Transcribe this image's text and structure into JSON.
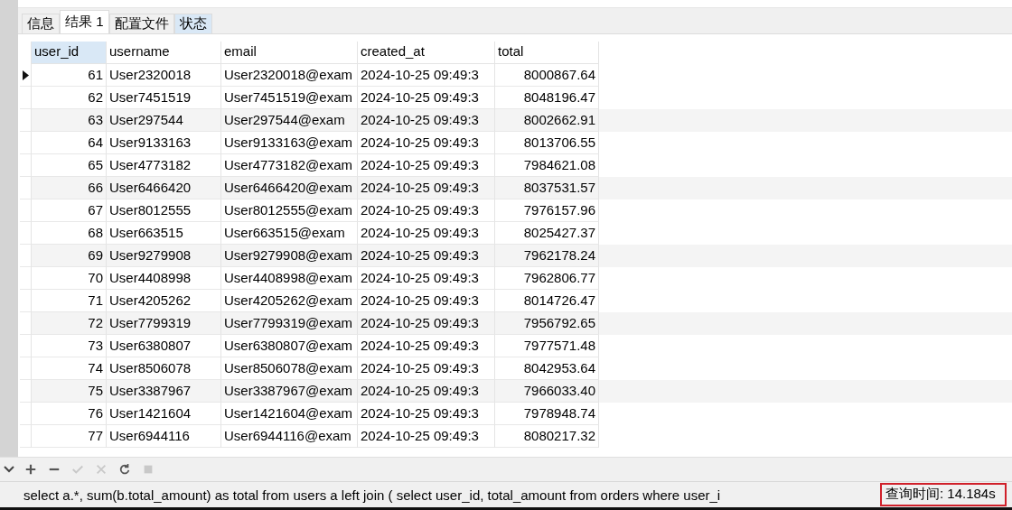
{
  "tabs": [
    {
      "label": "信息",
      "selected": false
    },
    {
      "label": "结果 1",
      "selected": true
    },
    {
      "label": "配置文件",
      "selected": false
    },
    {
      "label": "状态",
      "selected": false
    }
  ],
  "table": {
    "columns": [
      "user_id",
      "username",
      "email",
      "created_at",
      "total"
    ],
    "rows": [
      {
        "selected": true,
        "cells": [
          "61",
          "User2320018",
          "User2320018@exam",
          "2024-10-25 09:49:3",
          "8000867.64"
        ]
      },
      {
        "selected": false,
        "cells": [
          "62",
          "User7451519",
          "User7451519@exam",
          "2024-10-25 09:49:3",
          "8048196.47"
        ]
      },
      {
        "selected": false,
        "cells": [
          "63",
          "User297544",
          "User297544@exam",
          "2024-10-25 09:49:3",
          "8002662.91"
        ]
      },
      {
        "selected": false,
        "cells": [
          "64",
          "User9133163",
          "User9133163@exam",
          "2024-10-25 09:49:3",
          "8013706.55"
        ]
      },
      {
        "selected": false,
        "cells": [
          "65",
          "User4773182",
          "User4773182@exam",
          "2024-10-25 09:49:3",
          "7984621.08"
        ]
      },
      {
        "selected": false,
        "cells": [
          "66",
          "User6466420",
          "User6466420@exam",
          "2024-10-25 09:49:3",
          "8037531.57"
        ]
      },
      {
        "selected": false,
        "cells": [
          "67",
          "User8012555",
          "User8012555@exam",
          "2024-10-25 09:49:3",
          "7976157.96"
        ]
      },
      {
        "selected": false,
        "cells": [
          "68",
          "User663515",
          "User663515@exam",
          "2024-10-25 09:49:3",
          "8025427.37"
        ]
      },
      {
        "selected": false,
        "cells": [
          "69",
          "User9279908",
          "User9279908@exam",
          "2024-10-25 09:49:3",
          "7962178.24"
        ]
      },
      {
        "selected": false,
        "cells": [
          "70",
          "User4408998",
          "User4408998@exam",
          "2024-10-25 09:49:3",
          "7962806.77"
        ]
      },
      {
        "selected": false,
        "cells": [
          "71",
          "User4205262",
          "User4205262@exam",
          "2024-10-25 09:49:3",
          "8014726.47"
        ]
      },
      {
        "selected": false,
        "cells": [
          "72",
          "User7799319",
          "User7799319@exam",
          "2024-10-25 09:49:3",
          "7956792.65"
        ]
      },
      {
        "selected": false,
        "cells": [
          "73",
          "User6380807",
          "User6380807@exam",
          "2024-10-25 09:49:3",
          "7977571.48"
        ]
      },
      {
        "selected": false,
        "cells": [
          "74",
          "User8506078",
          "User8506078@exam",
          "2024-10-25 09:49:3",
          "8042953.64"
        ]
      },
      {
        "selected": false,
        "cells": [
          "75",
          "User3387967",
          "User3387967@exam",
          "2024-10-25 09:49:3",
          "7966033.40"
        ]
      },
      {
        "selected": false,
        "cells": [
          "76",
          "User1421604",
          "User1421604@exam",
          "2024-10-25 09:49:3",
          "7978948.74"
        ]
      },
      {
        "selected": false,
        "cells": [
          "77",
          "User6944116",
          "User6944116@exam",
          "2024-10-25 09:49:3",
          "8080217.32"
        ]
      }
    ]
  },
  "toolbar": [
    {
      "kind": "add",
      "disabled": false
    },
    {
      "kind": "remove",
      "disabled": false
    },
    {
      "kind": "apply",
      "disabled": true
    },
    {
      "kind": "cancel",
      "disabled": true
    },
    {
      "kind": "refresh",
      "disabled": false
    },
    {
      "kind": "stop",
      "disabled": true
    }
  ],
  "status_bar": {
    "query": "select a.*, sum(b.total_amount) as total from users a left join ( select user_id, total_amount from orders where user_i",
    "query_time": "查询时间: 14.184s",
    "highlighted": true
  }
}
